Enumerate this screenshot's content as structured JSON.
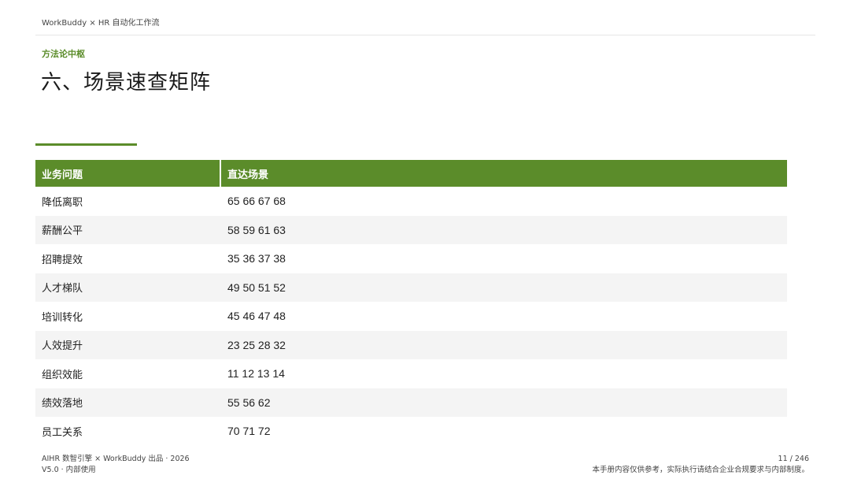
{
  "header": {
    "breadcrumb": "WorkBuddy × HR 自动化工作流"
  },
  "section": {
    "eyebrow": "方法论中枢",
    "title": "六、场景速查矩阵"
  },
  "colors": {
    "accent": "#5b8c2a",
    "row_alt": "#f4f4f4"
  },
  "table": {
    "headers": [
      "业务问题",
      "直达场景"
    ],
    "rows": [
      {
        "issue": "降低离职",
        "scenes": "65 66 67 68"
      },
      {
        "issue": "薪酬公平",
        "scenes": "58 59 61 63"
      },
      {
        "issue": "招聘提效",
        "scenes": "35 36 37 38"
      },
      {
        "issue": "人才梯队",
        "scenes": "49 50 51 52"
      },
      {
        "issue": "培训转化",
        "scenes": "45 46 47 48"
      },
      {
        "issue": "人效提升",
        "scenes": "23 25 28 32"
      },
      {
        "issue": "组织效能",
        "scenes": "11 12 13 14"
      },
      {
        "issue": "绩效落地",
        "scenes": "55 56 62"
      },
      {
        "issue": "员工关系",
        "scenes": "70 71 72"
      }
    ]
  },
  "footer": {
    "publisher": "AIHR 数智引擎 × WorkBuddy 出品 · 2026",
    "version": "V5.0 · 内部使用",
    "page": "11 / 246",
    "disclaimer": "本手册内容仅供参考，实际执行请结合企业合规要求与内部制度。"
  }
}
